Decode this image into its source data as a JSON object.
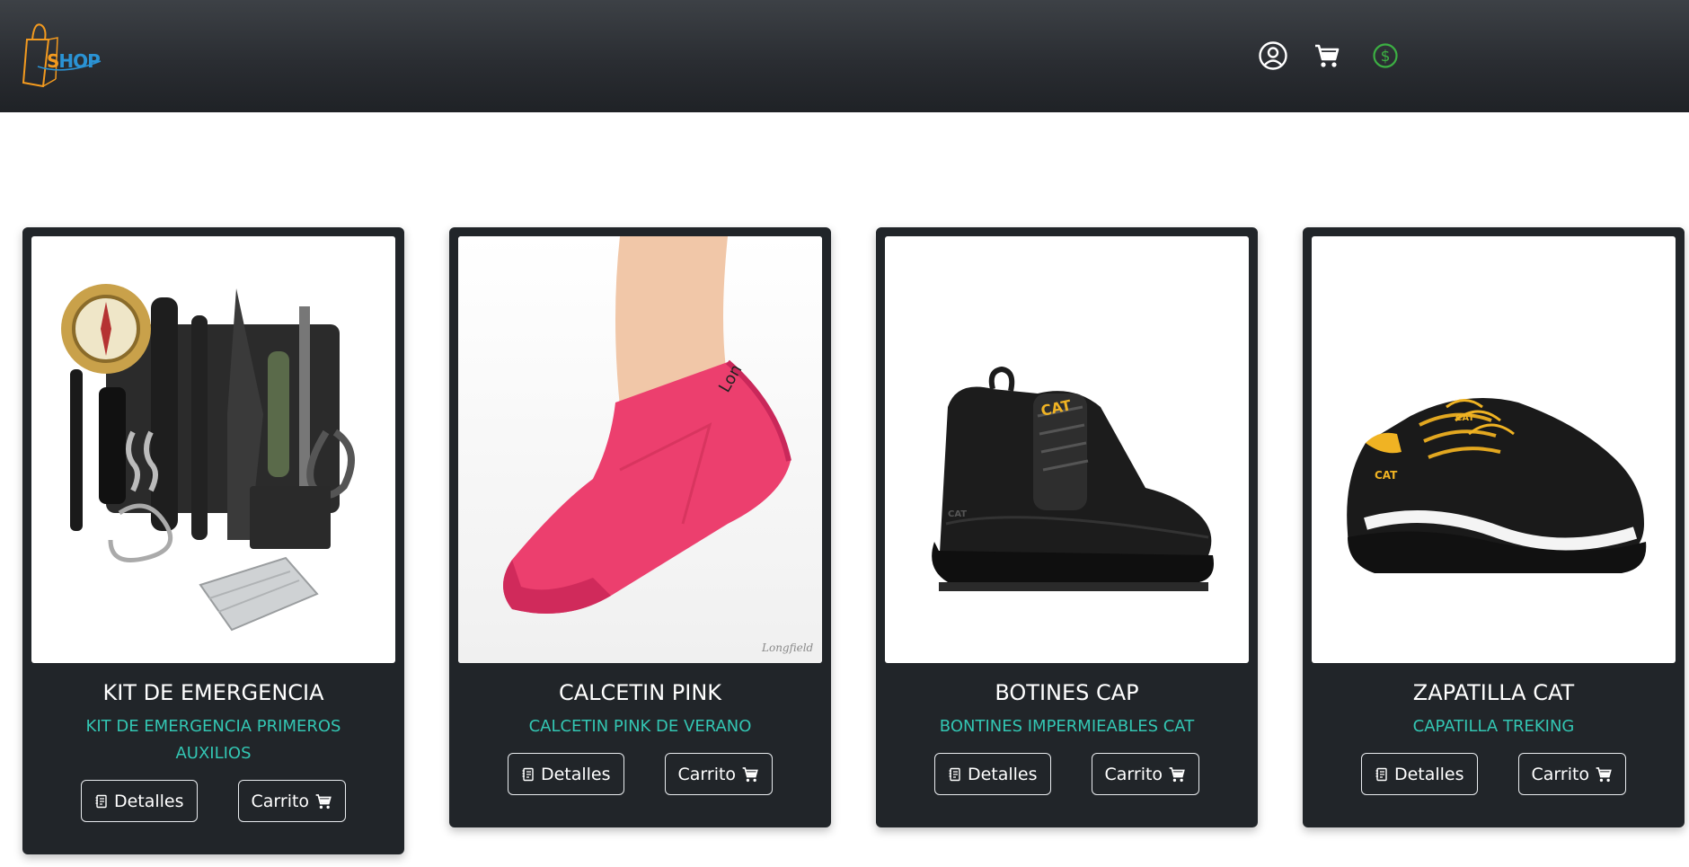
{
  "header": {
    "logo_text_s": "S",
    "logo_text_rest": "HOP",
    "icons": [
      "user-circle-icon",
      "cart-icon",
      "dollar-circle-icon"
    ],
    "accent_dollar": "#3cb043"
  },
  "products": [
    {
      "title": "KIT DE EMERGENCIA",
      "description": "KIT DE EMERGENCIA PRIMEROS AUXILIOS",
      "details_label": "Detalles",
      "cart_label": "Carrito"
    },
    {
      "title": "CALCETIN PINK",
      "description": "CALCETIN PINK DE VERANO",
      "details_label": "Detalles",
      "cart_label": "Carrito"
    },
    {
      "title": "BOTINES CAP",
      "description": "BONTINES IMPERMIEABLES CAT",
      "details_label": "Detalles",
      "cart_label": "Carrito"
    },
    {
      "title": "ZAPATILLA CAT",
      "description": "CAPATILLA TREKING",
      "details_label": "Detalles",
      "cart_label": "Carrito"
    }
  ],
  "colors": {
    "card_bg": "#212529",
    "description": "#33c6b3",
    "navbar_top": "#3d4146",
    "navbar_bottom": "#1f2226"
  }
}
